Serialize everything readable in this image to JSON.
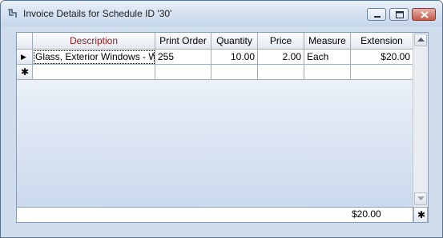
{
  "window": {
    "title": "Invoice Details for Schedule ID '30'",
    "controls": [
      "minimize-icon",
      "maximize-icon",
      "close-icon"
    ]
  },
  "grid": {
    "columns": [
      "Description",
      "Print Order",
      "Quantity",
      "Price",
      "Measure",
      "Extension"
    ],
    "rows": [
      {
        "description": "Glass, Exterior Windows - W",
        "print_order": "255",
        "quantity": "10.00",
        "price": "2.00",
        "measure": "Each",
        "extension": "$20.00"
      }
    ],
    "new_row_glyph": "✱",
    "current_row_glyph": "▶"
  },
  "footer": {
    "total_extension": "$20.00",
    "corner_glyph": "✱"
  },
  "colors": {
    "header_text_sorted": "#8b1b1b",
    "window_bg": "#cfdcec"
  }
}
